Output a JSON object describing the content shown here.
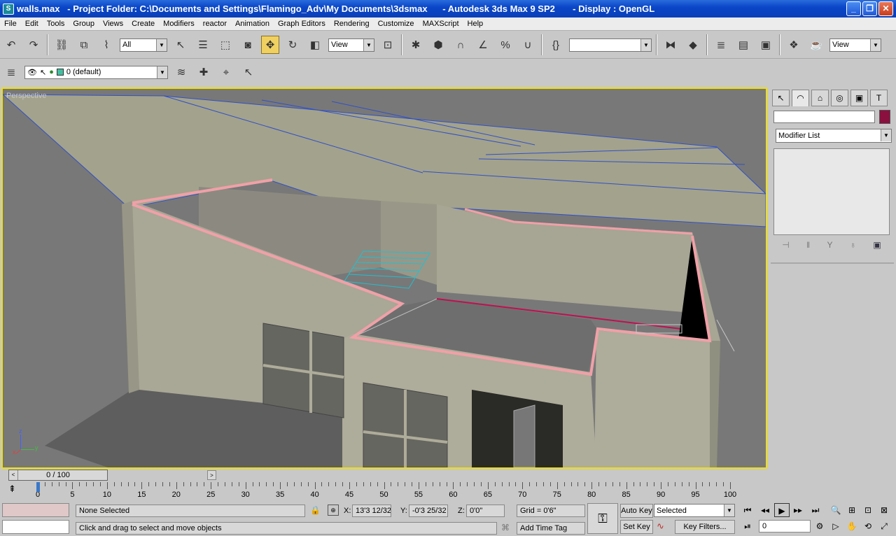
{
  "titlebar": {
    "file": "walls.max",
    "title": "   - Project Folder: C:\\Documents and Settings\\Flamingo_Adv\\My Documents\\3dsmax      - Autodesk 3ds Max 9 SP2       - Display : OpenGL",
    "minimize": "_",
    "maximize": "❐",
    "close": "✕"
  },
  "menu": [
    "File",
    "Edit",
    "Tools",
    "Group",
    "Views",
    "Create",
    "Modifiers",
    "reactor",
    "Animation",
    "Graph Editors",
    "Rendering",
    "Customize",
    "MAXScript",
    "Help"
  ],
  "toolbar": {
    "selection_filter": "All",
    "ref_coord": "View",
    "named_sel": "",
    "view_right": "View"
  },
  "layer_toolbar": {
    "layer": "0 (default)"
  },
  "viewport": {
    "label": "Perspective",
    "axis_z": "z",
    "axis_y": "y",
    "axis_x": "x"
  },
  "panel": {
    "name_value": "",
    "modifier_list": "Modifier List",
    "swatch_color": "#8b1040"
  },
  "timeslider": {
    "frame": "0 / 100",
    "left": "<",
    "right": ">"
  },
  "trackbar": {
    "labels": [
      "0",
      "5",
      "10",
      "15",
      "20",
      "25",
      "30",
      "35",
      "40",
      "45",
      "50",
      "55",
      "60",
      "65",
      "70",
      "75",
      "80",
      "85",
      "90",
      "95",
      "100"
    ]
  },
  "status": {
    "selection": "None Selected",
    "prompt": "Click and drag to select and move objects",
    "x_label": "X:",
    "x_value": "13'3 12/32",
    "y_label": "Y:",
    "y_value": "-0'3 25/32",
    "z_label": "Z:",
    "z_value": "0'0\"",
    "grid": "Grid = 0'6\"",
    "add_time_tag": "Add Time Tag",
    "auto_key": "Auto Key",
    "set_key": "Set Key",
    "key_mode": "Selected",
    "key_filters": "Key Filters...",
    "frame_value": "0"
  }
}
